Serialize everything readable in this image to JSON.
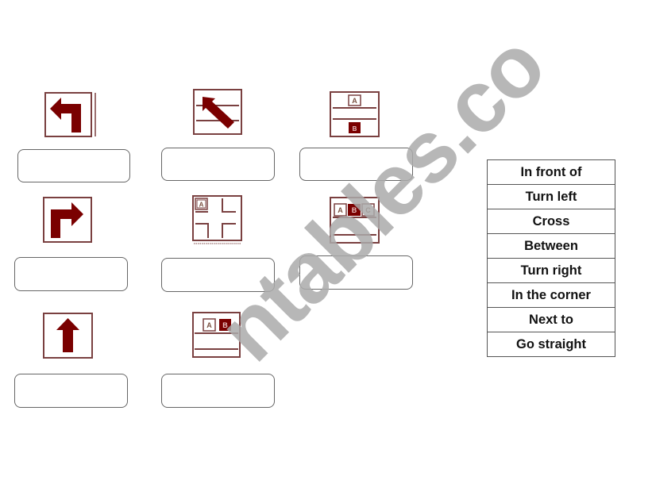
{
  "colors": {
    "sign_fill": "#7a0000",
    "sign_border": "#7a4040",
    "box_border": "#666666",
    "watermark": "#aaaaaa"
  },
  "signs": [
    {
      "id": 1,
      "icon": "turn-left-arrow-icon"
    },
    {
      "id": 2,
      "icon": "cross-street-arrow-icon"
    },
    {
      "id": 3,
      "icon": "in-front-of-icon",
      "labels": [
        "A",
        "B"
      ]
    },
    {
      "id": 4,
      "icon": "turn-right-arrow-icon"
    },
    {
      "id": 5,
      "icon": "in-the-corner-icon",
      "labels": [
        "A"
      ]
    },
    {
      "id": 6,
      "icon": "between-icon",
      "labels": [
        "A",
        "B",
        "C"
      ]
    },
    {
      "id": 7,
      "icon": "go-straight-arrow-icon"
    },
    {
      "id": 8,
      "icon": "next-to-icon",
      "labels": [
        "A",
        "B"
      ]
    }
  ],
  "answer_boxes": [
    {
      "value": ""
    },
    {
      "value": ""
    },
    {
      "value": ""
    },
    {
      "value": ""
    },
    {
      "value": ""
    },
    {
      "value": ""
    },
    {
      "value": ""
    },
    {
      "value": ""
    }
  ],
  "word_bank": [
    "In front of",
    "Turn left",
    "Cross",
    "Between",
    "Turn right",
    "In the corner",
    "Next to",
    "Go straight"
  ],
  "watermark": "eslprintables.com",
  "watermark_visible": "ntables.co"
}
